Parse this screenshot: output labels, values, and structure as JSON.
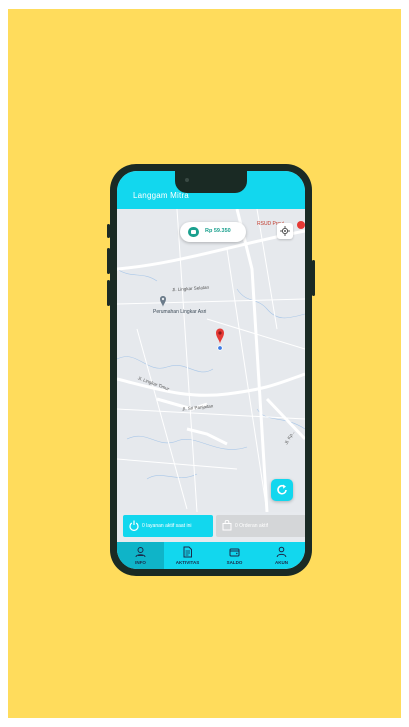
{
  "colors": {
    "backdrop": "#ffdc5c",
    "accent": "#12d7ee",
    "balance_green": "#1aa08e",
    "pin_red": "#e53935",
    "phone_frame": "#1a2a24"
  },
  "app": {
    "title": "Langgam Mitra"
  },
  "map": {
    "balance": {
      "icon": "wallet-icon",
      "amount": "Rp 59.350"
    },
    "poi_label": "RSUD Provi...",
    "place_label": "Perumahan Lingkar Asri",
    "road_labels": [
      "Jl. Lingkar Selatan",
      "Jl. Lingkar Timur",
      "Jl. Sri Panjaitan",
      "Jl. Kp..."
    ],
    "recenter_icon": "crosshair-icon",
    "refresh_icon": "refresh-icon"
  },
  "status_panel": {
    "active_service": {
      "icon": "power-icon",
      "text": "0 layanan aktif saat ini"
    },
    "active_order": {
      "icon": "bag-icon",
      "text": "0 Orderan aktif"
    }
  },
  "bottom_nav": {
    "items": [
      {
        "label": "INFO",
        "icon": "location-user-icon",
        "active": true
      },
      {
        "label": "AKTIVITAS",
        "icon": "document-icon",
        "active": false
      },
      {
        "label": "SALDO",
        "icon": "wallet-icon",
        "active": false
      },
      {
        "label": "AKUN",
        "icon": "person-icon",
        "active": false
      }
    ]
  }
}
